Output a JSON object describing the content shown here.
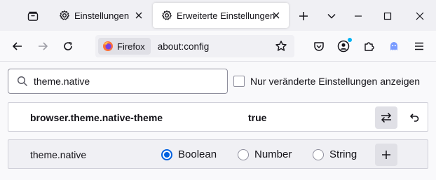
{
  "tabs": [
    {
      "label": "Einstellungen",
      "icon": "gear-icon"
    },
    {
      "label": "Erweiterte Einstellungen",
      "icon": "gear-icon",
      "active": true
    }
  ],
  "navbar": {
    "identity_label": "Firefox",
    "url": "about:config"
  },
  "search": {
    "value": "theme.native"
  },
  "modified_only": {
    "label": "Nur veränderte Einstellungen anzeigen",
    "checked": false
  },
  "prefs": [
    {
      "name": "browser.theme.native-theme",
      "value": "true"
    }
  ],
  "new_pref": {
    "name": "theme.native",
    "types": [
      "Boolean",
      "Number",
      "String"
    ],
    "selected": "Boolean"
  },
  "colors": {
    "accent": "#0061e0",
    "extension_ghost": "#7a9cff",
    "notification_dot": "#00b3f4"
  }
}
